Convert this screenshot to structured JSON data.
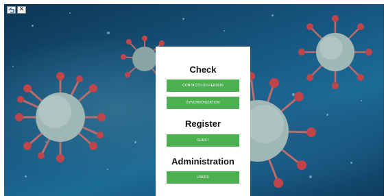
{
  "window_controls": {
    "restore_icon": "restore-icon",
    "close_icon": "close-icon",
    "close_glyph": "✕"
  },
  "sections": {
    "check": {
      "title": "Check",
      "buttons": [
        "CONTACTS OF PERSON",
        "SYNCHRONIZATION"
      ]
    },
    "register": {
      "title": "Register",
      "buttons": [
        "GUEST"
      ]
    },
    "administration": {
      "title": "Administration",
      "buttons": [
        "USERS"
      ]
    }
  },
  "colors": {
    "button_green": "#4caf50",
    "panel_background": "#ffffff",
    "virus_body": "#9fb7b5",
    "virus_spike": "#c0454a"
  }
}
